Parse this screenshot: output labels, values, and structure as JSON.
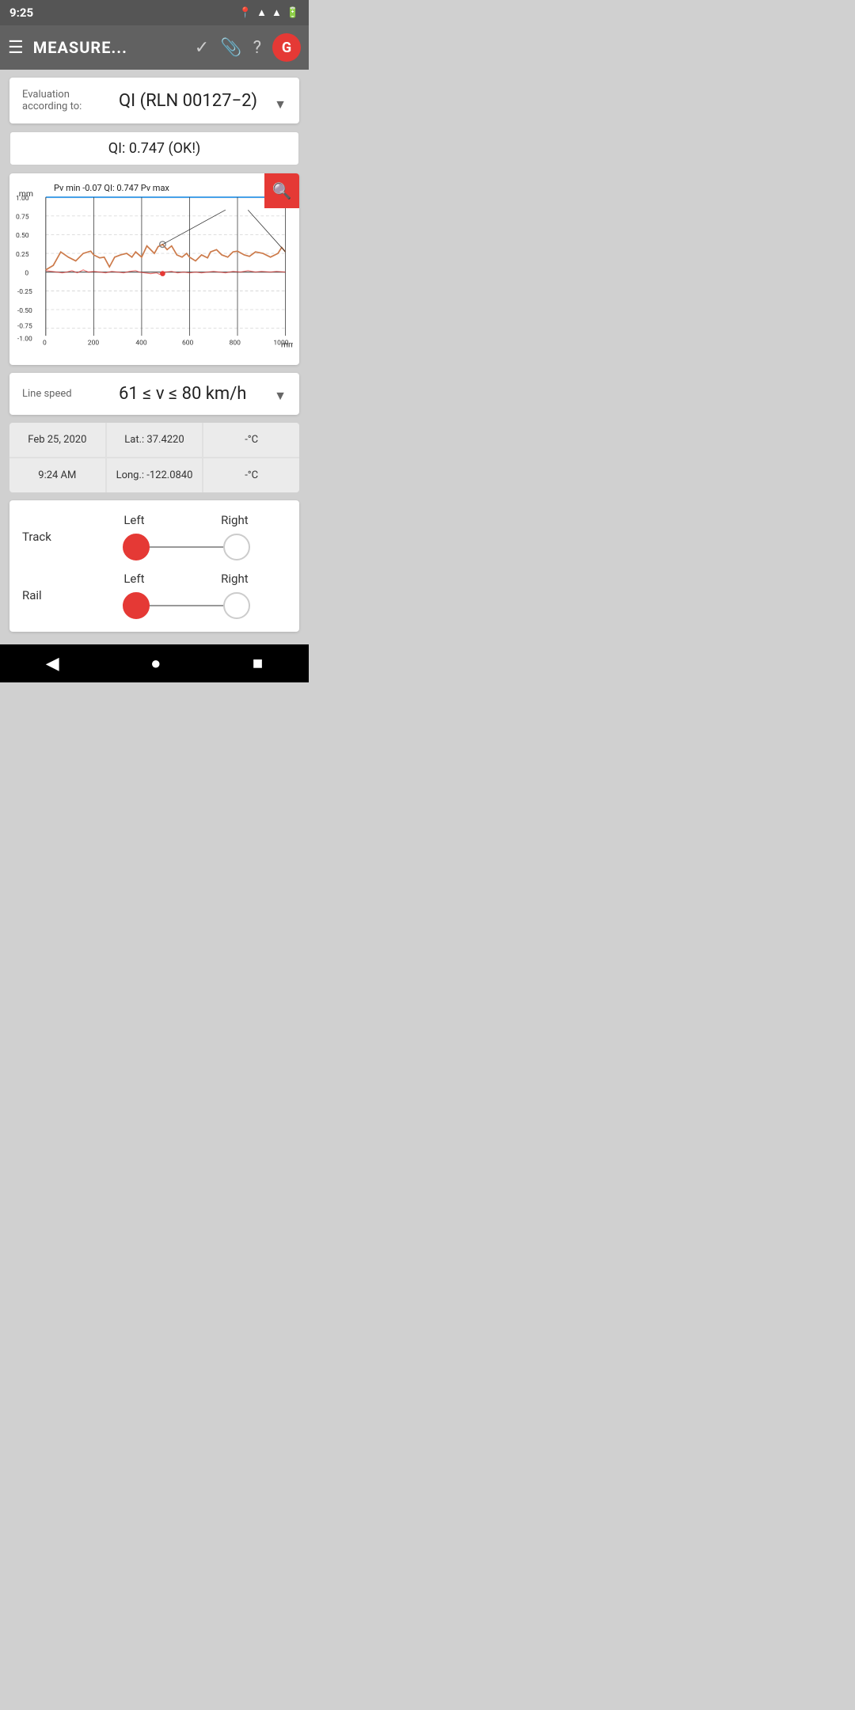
{
  "statusBar": {
    "time": "9:25",
    "icons": [
      "📍",
      "▲",
      "▲",
      "🔋"
    ]
  },
  "appBar": {
    "menuIcon": "☰",
    "title": "MEASURE...",
    "checkIcon": "✓",
    "clipIcon": "📎",
    "helpIcon": "?",
    "avatarLabel": "G"
  },
  "evalCard": {
    "label": "Evaluation according to:",
    "value": "QI (RLN 00127−2)",
    "dropdownArrow": "▼"
  },
  "qiResult": {
    "text": "QI: 0.747  (OK!)"
  },
  "chart": {
    "tooltip": "Pv min -0.07  QI: 0.747  Pv max",
    "yLabel": "mm",
    "xLabel": "mm",
    "yAxis": [
      "1.00",
      "0.75",
      "0.50",
      "0.25",
      "0",
      "-0.25",
      "-0.50",
      "-0.75",
      "-1.00"
    ],
    "xAxis": [
      "0",
      "200",
      "400",
      "600",
      "800",
      "1000"
    ],
    "searchIcon": "🔍"
  },
  "speedCard": {
    "label": "Line speed",
    "value": "61 ≤ v ≤ 80 km/h",
    "dropdownArrow": "▼"
  },
  "infoGrid": {
    "cells": [
      "Feb 25, 2020",
      "Lat.: 37.4220",
      "-°C",
      "9:24 AM",
      "Long.: -122.0840",
      "-°C"
    ]
  },
  "trackSelector": {
    "rowLabel": "Track",
    "leftLabel": "Left",
    "rightLabel": "Right",
    "leftSelected": true,
    "rightSelected": false
  },
  "railSelector": {
    "rowLabel": "Rail",
    "leftLabel": "Left",
    "rightLabel": "Right",
    "leftSelected": true,
    "rightSelected": false
  },
  "bottomNav": {
    "back": "◀",
    "home": "●",
    "recent": "■"
  }
}
